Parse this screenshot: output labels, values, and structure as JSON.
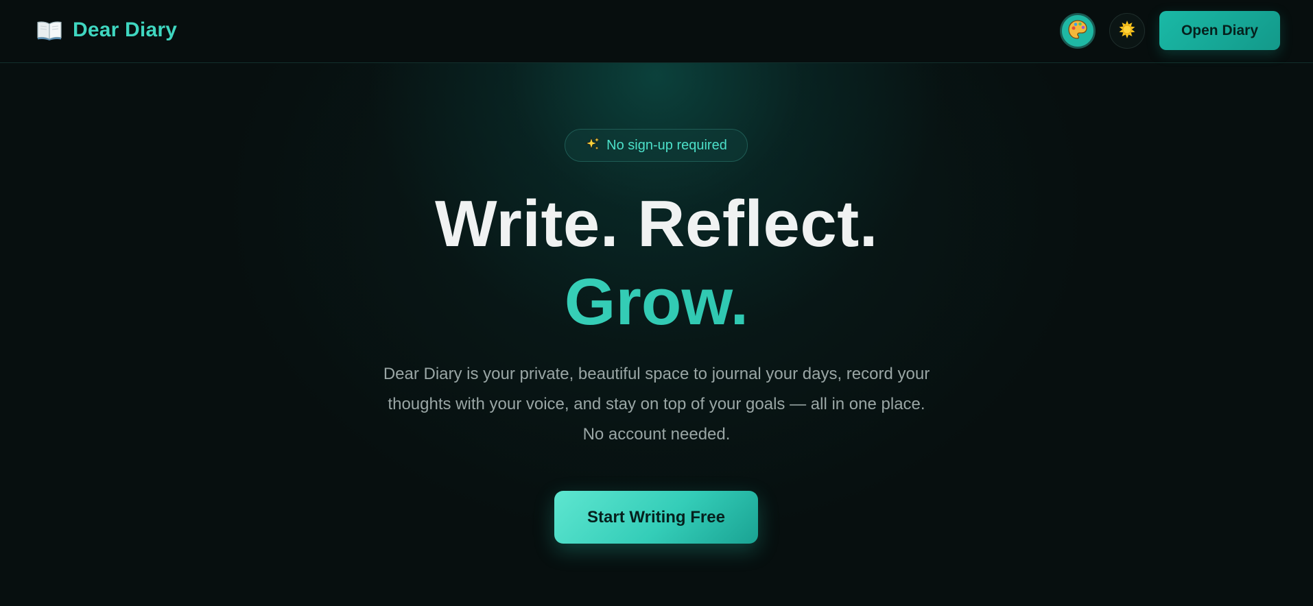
{
  "header": {
    "brand_icon": "open-book-icon",
    "brand_name": "Dear Diary",
    "palette_button_icon": "palette-icon",
    "theme_toggle_icon": "sun-icon",
    "open_button_label": "Open Diary"
  },
  "hero": {
    "badge_icon": "sparkles-icon",
    "badge_text": "No sign-up required",
    "headline_line1": "Write. Reflect.",
    "headline_line2": "Grow.",
    "description_lines": [
      "Dear Diary is your private, beautiful space to journal your days, record your",
      "thoughts with your voice, and stay on top of your goals — all in one place.",
      "No account needed."
    ],
    "cta_label": "Start Writing Free"
  },
  "colors": {
    "accent": "#3fd6c0",
    "background": "#070f0f",
    "button": "#1ab9a6"
  }
}
